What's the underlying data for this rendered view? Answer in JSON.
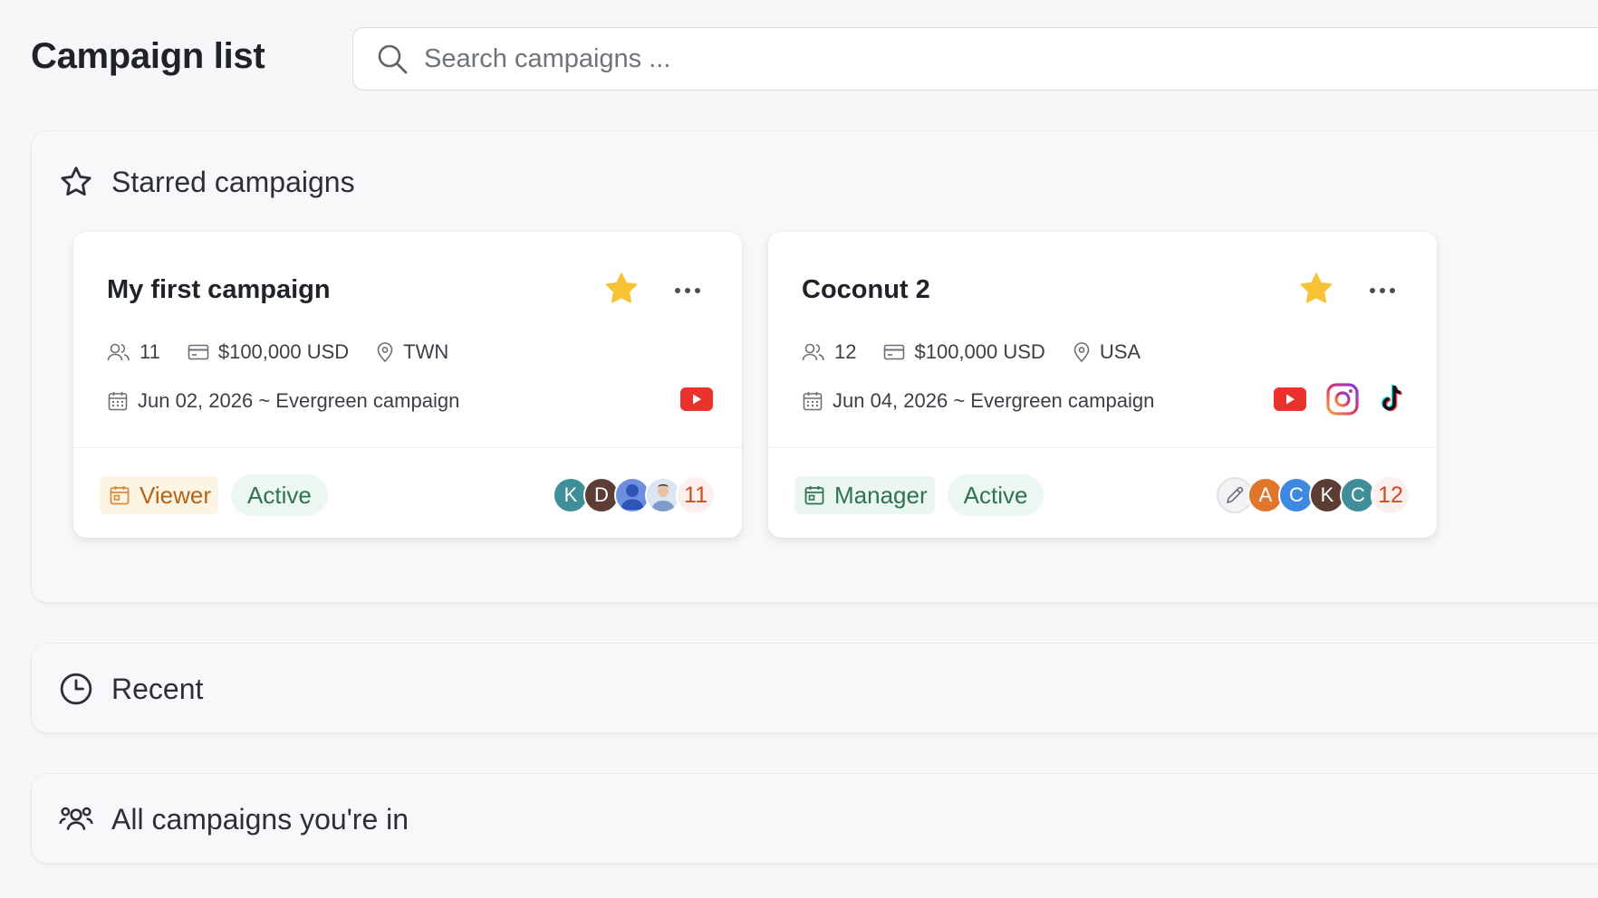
{
  "header": {
    "title": "Campaign list",
    "search_placeholder": "Search campaigns ..."
  },
  "colors": {
    "star": "#f7c233",
    "youtube": "#e8322b",
    "viewer_text": "#b6641a",
    "viewer_bg": "#fdf4e3",
    "manager_text": "#2f7350",
    "manager_bg": "#eaf6ef",
    "count_text": "#cd4d25"
  },
  "sections": {
    "starred": {
      "title": "Starred campaigns",
      "icon": "star-outline-icon"
    },
    "recent": {
      "title": "Recent",
      "icon": "clock-icon"
    },
    "all": {
      "title": "All campaigns you're in",
      "icon": "users-group-icon"
    }
  },
  "campaigns": [
    {
      "title": "My first campaign",
      "starred": true,
      "members": "11",
      "budget": "$100,000 USD",
      "location": "TWN",
      "date": "Jun 02, 2026 ~ Evergreen campaign",
      "platforms": [
        "youtube-icon"
      ],
      "role": "Viewer",
      "status": "Active",
      "avatars": [
        {
          "initial": "K",
          "color": "#3f8e9a"
        },
        {
          "initial": "D",
          "color": "#5b3d33"
        },
        {
          "initial": "",
          "color": "#6d8fe0",
          "icon": "person-placeholder-icon"
        },
        {
          "initial": "",
          "color": "#c9d6ea",
          "icon": "photo-avatar-icon"
        }
      ],
      "member_count": "11"
    },
    {
      "title": "Coconut 2",
      "starred": true,
      "members": "12",
      "budget": "$100,000 USD",
      "location": "USA",
      "date": "Jun 04, 2026 ~ Evergreen campaign",
      "platforms": [
        "youtube-icon",
        "instagram-icon",
        "tiktok-icon"
      ],
      "role": "Manager",
      "status": "Active",
      "avatars": [
        {
          "initial": "",
          "color": "#f3f3f5",
          "icon": "pencil-icon"
        },
        {
          "initial": "A",
          "color": "#e0762c"
        },
        {
          "initial": "C",
          "color": "#3e88e0"
        },
        {
          "initial": "K",
          "color": "#5b3d33"
        },
        {
          "initial": "C",
          "color": "#3f8e9a"
        }
      ],
      "member_count": "12"
    }
  ]
}
